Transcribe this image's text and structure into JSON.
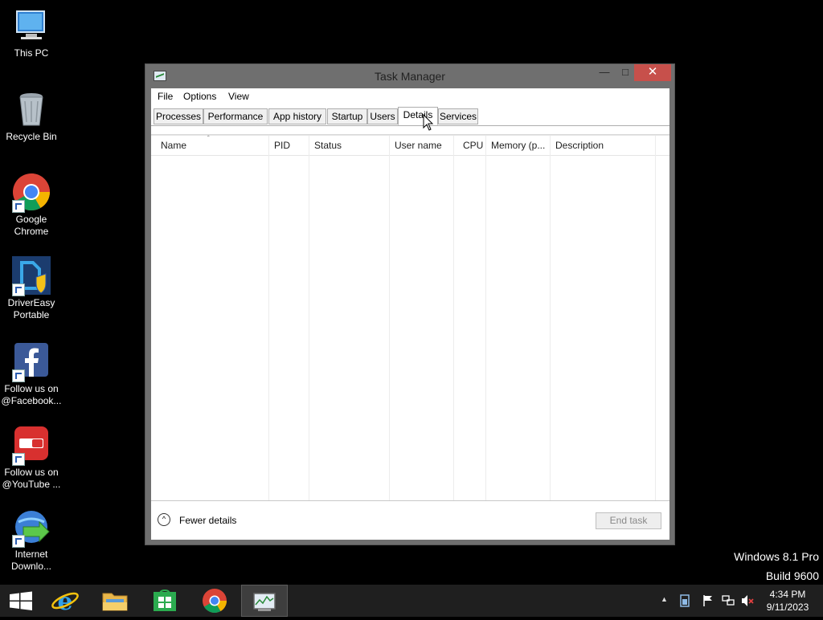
{
  "desktop": {
    "icons": [
      {
        "label": "This PC",
        "icon": "computer-icon"
      },
      {
        "label": "Recycle Bin",
        "icon": "recycle-bin-icon"
      },
      {
        "label": "Google Chrome",
        "icon": "chrome-icon"
      },
      {
        "label": "DriverEasy Portable",
        "icon": "drivereasy-icon"
      },
      {
        "label": "Follow us on @Facebook...",
        "icon": "facebook-icon"
      },
      {
        "label": "Follow us on @YouTube ...",
        "icon": "youtube-icon"
      },
      {
        "label": "Internet Downlo...",
        "icon": "idm-icon"
      }
    ]
  },
  "window": {
    "title": "Task Manager",
    "minimize_glyph": "—",
    "maximize_glyph": "□",
    "close_glyph": "✕",
    "menu": [
      "File",
      "Options",
      "View"
    ],
    "tabs": [
      "Processes",
      "Performance",
      "App history",
      "Startup",
      "Users",
      "Details",
      "Services"
    ],
    "active_tab": "Details",
    "columns": [
      "Name",
      "PID",
      "Status",
      "User name",
      "CPU",
      "Memory (p...",
      "Description"
    ],
    "sort_glyph": "ˆ",
    "fewer_details_glyph": "^",
    "fewer_details_label": "Fewer details",
    "end_task_label": "End task"
  },
  "watermark": {
    "line1": "Windows 8.1 Pro",
    "line2": "Build 9600"
  },
  "taskbar": {
    "apps": [
      "start-icon",
      "internet-explorer-icon",
      "file-explorer-icon",
      "store-icon",
      "chrome-icon",
      "task-manager-icon"
    ],
    "tray": [
      "up-arrow-icon",
      "battery-icon",
      "flag-icon",
      "network-icon",
      "volume-muted-icon"
    ],
    "tray_up_glyph": "▲",
    "time": "4:34 PM",
    "date": "9/11/2023"
  },
  "colors": {
    "close_button": "#c7504b",
    "desktop_bg": "#000000",
    "taskbar_bg": "#1f1f1f"
  }
}
